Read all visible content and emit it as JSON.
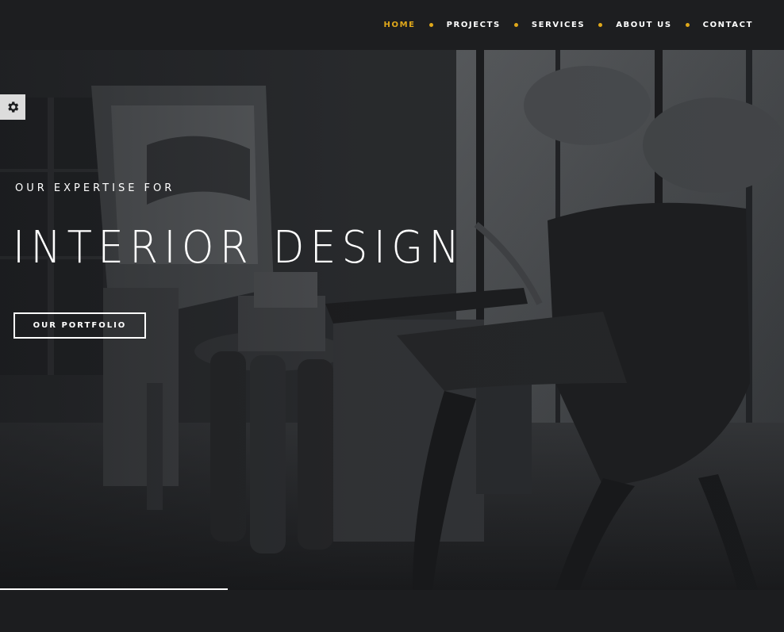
{
  "nav": {
    "items": [
      {
        "label": "HOME",
        "active": true
      },
      {
        "label": "PROJECTS",
        "active": false
      },
      {
        "label": "SERVICES",
        "active": false
      },
      {
        "label": "ABOUT US",
        "active": false
      },
      {
        "label": "CONTACT",
        "active": false
      }
    ],
    "accent_color": "#e0a81a"
  },
  "hero": {
    "kicker": "OUR EXPERTISE FOR",
    "title": "INTERIOR DESIGN",
    "button_label": "OUR PORTFOLIO",
    "slide_progress": 0.29
  },
  "settings": {
    "icon": "gear-icon"
  }
}
